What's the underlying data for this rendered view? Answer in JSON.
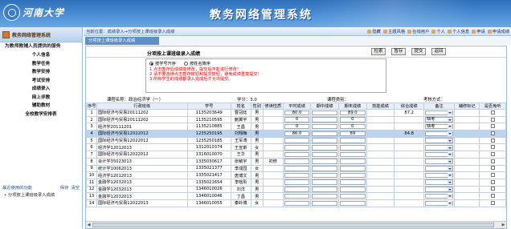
{
  "header": {
    "logo_text": "河南大学",
    "system_title": "教务网络管理系统"
  },
  "sidebar": {
    "title": "教务网络管理系统",
    "section": "为教师教辅人员提供的服务",
    "items": [
      "个人信息",
      "教学任务",
      "教学安排",
      "考试安排",
      "成绩录入",
      "网上评教",
      "辅助教材",
      "全校教学安排表"
    ],
    "recent_title": "最近使用的功能",
    "recent_save": "保存",
    "recent_clear": "清空",
    "recent_items": [
      "分项按上课班级录入成绩"
    ]
  },
  "topbar": {
    "breadcrumb": "当前位置：成绩录入→分项按上课班级录入成绩",
    "tools": [
      "隐藏",
      "主题风格",
      "在线用户",
      "个人",
      "个人信息",
      "申请",
      "申请成绩"
    ]
  },
  "tab": {
    "label": "分项按上课班级录入成绩"
  },
  "panel": {
    "title": "分项按上课班级录入成绩",
    "buttons": [
      "检索",
      "暂存",
      "提交",
      "返回"
    ],
    "sort_options": [
      "按学号升序",
      "按姓名降序"
    ],
    "notices": [
      "1.点击暂存后成绩能修改，提交后不能进行修改！",
      "2.请不要连续点击暂存按钮和提交按钮，避免成绩重复提交！",
      "3.所有学生的成绩都录入完成后才允许提交。"
    ]
  },
  "course": {
    "course_name": "课程名称：政治经济学（一）",
    "credit": "学分：3.0",
    "course_category": "课程类别：",
    "exam_method": "考核方式："
  },
  "table": {
    "headers": [
      "序号",
      "行政班级",
      "学号",
      "姓名",
      "性别",
      "修读性质",
      "平时成绩",
      "期中成绩",
      "期末成绩",
      "技能成绩",
      "综合成绩",
      "备注",
      "辅修标记",
      "是否免听"
    ],
    "rows": [
      {
        "no": "1",
        "class": "国际经济与贸易20111202",
        "id": "1135203649",
        "name": "曹冠廷",
        "sex": "男",
        "nature": "",
        "usual": "80.0",
        "mid": "",
        "final": "89.0",
        "skill": "",
        "total": "87.2",
        "remark": "",
        "minor": "",
        "exempt": ""
      },
      {
        "no": "2",
        "class": "国际经济与贸易20111202",
        "id": "1135210595",
        "name": "鲍翼宇",
        "sex": "男",
        "nature": "",
        "usual": "0",
        "mid": "",
        "final": "0",
        "skill": "",
        "total": "",
        "remark": "缺考",
        "minor": "",
        "exempt": ""
      },
      {
        "no": "3",
        "class": "经济学20111201",
        "id": "1135210885",
        "name": "王昌",
        "sex": "男",
        "nature": "",
        "usual": "0",
        "mid": "",
        "final": "0",
        "skill": "",
        "total": "",
        "remark": "缺考",
        "minor": "",
        "exempt": ""
      },
      {
        "no": "4",
        "class": "国际经济与贸易12022012",
        "id": "1235250195",
        "name": "刘翔梅",
        "sex": "男",
        "nature": "",
        "usual": "86.0",
        "mid": "",
        "final": "89",
        "skill": "",
        "total": "84.8",
        "remark": "",
        "minor": "",
        "exempt": ""
      },
      {
        "no": "5",
        "class": "国际经济与贸易12022012",
        "id": "1235250185",
        "name": "王军涛",
        "sex": "男",
        "nature": "",
        "usual": "",
        "mid": "",
        "final": "",
        "skill": "",
        "total": "",
        "remark": "",
        "minor": "",
        "exempt": ""
      },
      {
        "no": "6",
        "class": "经济学12012013",
        "id": "1312010374",
        "name": "王宣斯",
        "sex": "女",
        "nature": "",
        "usual": "",
        "mid": "",
        "final": "",
        "skill": "",
        "total": "",
        "remark": "",
        "minor": "",
        "exempt": ""
      },
      {
        "no": "7",
        "class": "国际经济与贸易12022012",
        "id": "1316010070",
        "name": "王华",
        "sex": "男",
        "nature": "",
        "usual": "",
        "mid": "",
        "final": "",
        "skill": "",
        "total": "",
        "remark": "",
        "minor": "",
        "exempt": ""
      },
      {
        "no": "8",
        "class": "会计学35023013",
        "id": "1335030617",
        "name": "张敏宇",
        "sex": "男",
        "nature": "初修",
        "usual": "",
        "mid": "",
        "final": "",
        "skill": "",
        "total": "",
        "remark": "",
        "minor": "",
        "exempt": ""
      },
      {
        "no": "9",
        "class": "统计学10062013",
        "id": "1335021377",
        "name": "李成园",
        "sex": "女",
        "nature": "",
        "usual": "",
        "mid": "",
        "final": "",
        "skill": "",
        "total": "",
        "remark": "",
        "minor": "",
        "exempt": ""
      },
      {
        "no": "10",
        "class": "经济学12012013",
        "id": "1335021417",
        "name": "唐博文",
        "sex": "男",
        "nature": "",
        "usual": "",
        "mid": "",
        "final": "",
        "skill": "",
        "total": "",
        "remark": "",
        "minor": "",
        "exempt": ""
      },
      {
        "no": "11",
        "class": "金融学12032013",
        "id": "1335021654",
        "name": "李晗彤",
        "sex": "男",
        "nature": "",
        "usual": "",
        "mid": "",
        "final": "",
        "skill": "",
        "total": "",
        "remark": "",
        "minor": "",
        "exempt": ""
      },
      {
        "no": "12",
        "class": "金融学12032013",
        "id": "1346010026",
        "name": "刘洋",
        "sex": "男",
        "nature": "",
        "usual": "",
        "mid": "",
        "final": "",
        "skill": "",
        "total": "",
        "remark": "",
        "minor": "",
        "exempt": ""
      },
      {
        "no": "13",
        "class": "金融学12032013",
        "id": "1346010046",
        "name": "丁昌",
        "sex": "男",
        "nature": "",
        "usual": "",
        "mid": "",
        "final": "",
        "skill": "",
        "total": "",
        "remark": "",
        "minor": "",
        "exempt": ""
      },
      {
        "no": "14",
        "class": "国际经济与贸易12022013",
        "id": "1346010055",
        "name": "秦岭博",
        "sex": "女",
        "nature": "",
        "usual": "",
        "mid": "",
        "final": "",
        "skill": "",
        "total": "",
        "remark": "",
        "minor": "",
        "exempt": ""
      }
    ],
    "selected_row": 3
  },
  "colors": {
    "header_blue": "#2d6fb8",
    "selected_row": "#bcd4ef",
    "notice_red": "#dd0000",
    "sidebar_accent": "#d8762c"
  }
}
